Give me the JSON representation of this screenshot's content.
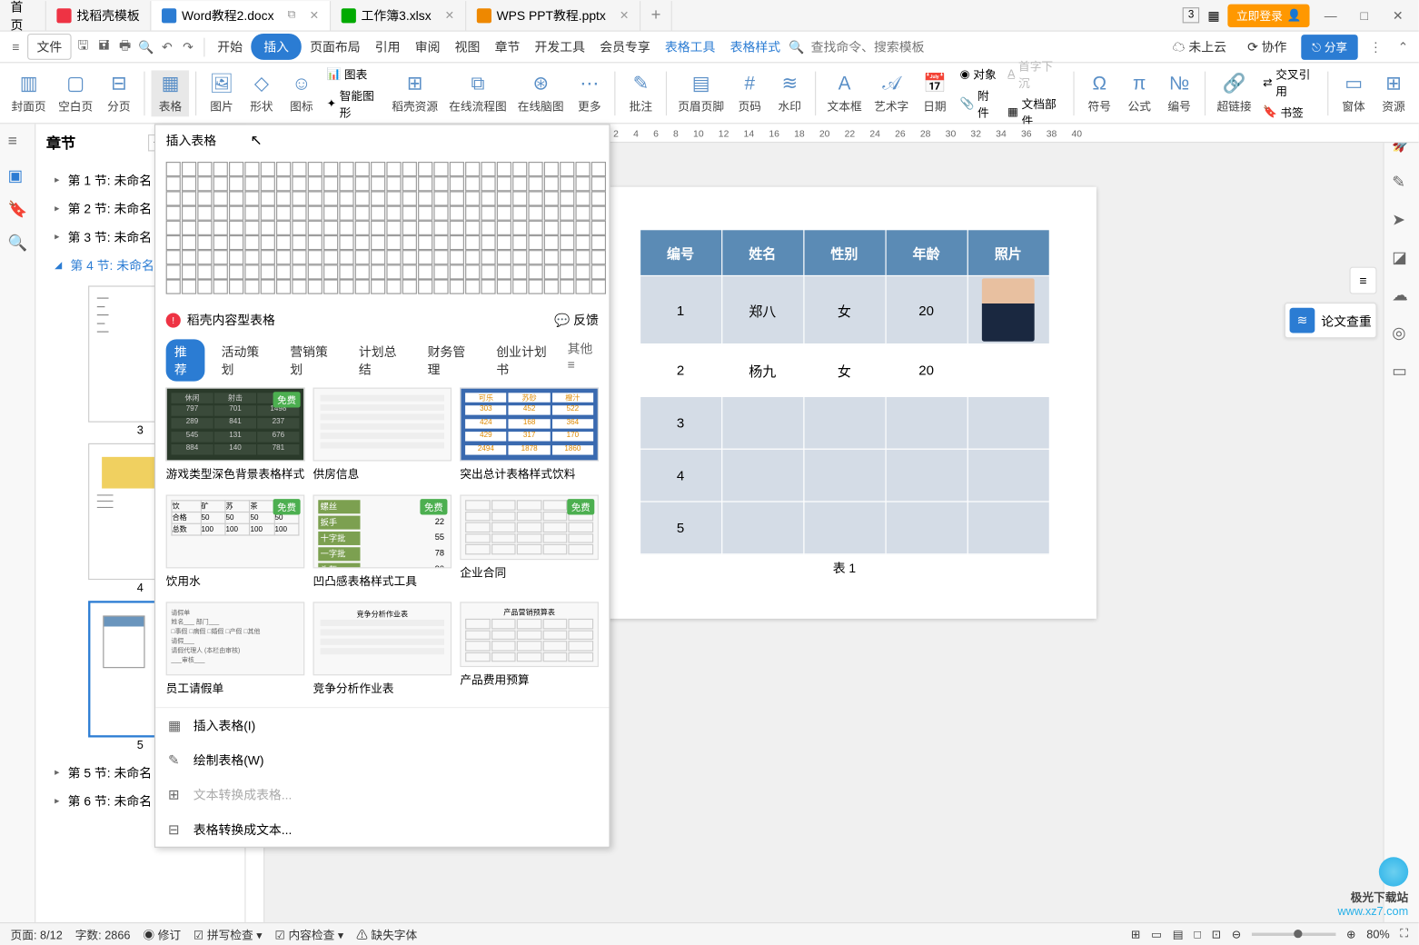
{
  "tabs": {
    "home": "首页",
    "t1": "找稻壳模板",
    "t2": "Word教程2.docx",
    "t3": "工作簿3.xlsx",
    "t4": "WPS PPT教程.pptx"
  },
  "titlebar": {
    "login": "立即登录",
    "sheet_num": "3"
  },
  "menu": {
    "file": "文件",
    "items": [
      "开始",
      "插入",
      "页面布局",
      "引用",
      "审阅",
      "视图",
      "章节",
      "开发工具",
      "会员专享"
    ],
    "extra": [
      "表格工具",
      "表格样式"
    ],
    "search_placeholder": "查找命令、搜索模板",
    "cloud": "未上云",
    "collab": "协作",
    "share": "分享"
  },
  "ribbon": {
    "cover": "封面页",
    "blank": "空白页",
    "break": "分页",
    "table": "表格",
    "pic": "图片",
    "shape": "形状",
    "icon": "图标",
    "chart": "图表",
    "smart": "智能图形",
    "res": "稻壳资源",
    "flow": "在线流程图",
    "mind": "在线脑图",
    "more": "更多",
    "comment": "批注",
    "header": "页眉页脚",
    "pagenum": "页码",
    "water": "水印",
    "textbox": "文本框",
    "art": "艺术字",
    "date": "日期",
    "obj": "对象",
    "attach": "附件",
    "first": "首字下沉",
    "docpart": "文档部件",
    "symbol": "符号",
    "formula": "公式",
    "num": "编号",
    "link": "超链接",
    "xref": "交叉引用",
    "bookmark": "书签",
    "pane": "窗体",
    "resource": "资源"
  },
  "nav": {
    "title": "章节",
    "items": [
      "第 1 节: 未命名",
      "第 2 节: 未命名",
      "第 3 节: 未命名",
      "第 4 节: 未命名",
      "第 5 节: 未命名",
      "第 6 节: 未命名"
    ],
    "thumb_nums": [
      "3",
      "4",
      "5"
    ]
  },
  "ruler": [
    "2",
    "4",
    "6",
    "8",
    "10",
    "12",
    "14",
    "16",
    "18",
    "20",
    "22",
    "24",
    "26",
    "28",
    "30",
    "32",
    "34",
    "36",
    "38",
    "40"
  ],
  "doc_table": {
    "headers": [
      "编号",
      "姓名",
      "性别",
      "年龄",
      "照片"
    ],
    "rows": [
      [
        "1",
        "郑八",
        "女",
        "20",
        ""
      ],
      [
        "2",
        "杨九",
        "女",
        "20",
        ""
      ],
      [
        "3",
        "",
        "",
        "",
        ""
      ],
      [
        "4",
        "",
        "",
        "",
        ""
      ],
      [
        "5",
        "",
        "",
        "",
        ""
      ]
    ],
    "caption": "表 1"
  },
  "dropdown": {
    "header": "插入表格",
    "temp_title": "稻壳内容型表格",
    "feedback": "反馈",
    "tabs": [
      "推荐",
      "活动策划",
      "营销策划",
      "计划总结",
      "财务管理",
      "创业计划书"
    ],
    "tabs_more": "其他",
    "templates": [
      {
        "name": "游戏类型深色背景表格样式",
        "badge": "免费"
      },
      {
        "name": "供房信息",
        "badge": ""
      },
      {
        "name": "突出总计表格样式饮料",
        "badge": ""
      },
      {
        "name": "饮用水",
        "badge": "免费"
      },
      {
        "name": "凹凸感表格样式工具",
        "badge": "免费"
      },
      {
        "name": "企业合同",
        "badge": "免费"
      },
      {
        "name": "员工请假单",
        "badge": ""
      },
      {
        "name": "竞争分析作业表",
        "badge": ""
      },
      {
        "name": "产品费用预算",
        "badge": ""
      }
    ],
    "actions": {
      "insert": "插入表格(I)",
      "draw": "绘制表格(W)",
      "text2table": "文本转换成表格...",
      "table2text": "表格转换成文本..."
    }
  },
  "right_float": "论文查重",
  "status": {
    "page": "页面: 8/12",
    "words": "字数: 2866",
    "track": "修订",
    "spell": "拼写检查",
    "content": "内容检查",
    "font": "缺失字体",
    "zoom": "80%"
  },
  "watermark": {
    "name": "极光下载站",
    "url": "www.xz7.com"
  }
}
